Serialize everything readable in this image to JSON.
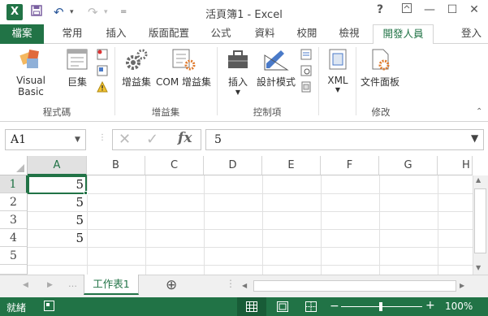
{
  "window": {
    "title": "活頁簿1 - Excel",
    "help": "?",
    "minimize": "—",
    "maximize": "☐",
    "close": "✕"
  },
  "quick_access": {
    "app_icon": "excel-icon",
    "undo_glyph": "↶",
    "redo_glyph": "↷",
    "customize_glyph": "⌄"
  },
  "tabs": [
    "檔案",
    "常用",
    "插入",
    "版面配置",
    "公式",
    "資料",
    "校閱",
    "檢視",
    "開發人員"
  ],
  "active_tab": "開發人員",
  "sign_in": "登入",
  "ribbon": {
    "groups": [
      {
        "label": "程式碼",
        "buttons": [
          "Visual Basic",
          "巨集"
        ]
      },
      {
        "label": "增益集",
        "buttons": [
          "增益集",
          "COM 增益集"
        ]
      },
      {
        "label": "控制項",
        "buttons": [
          "插入",
          "設計模式"
        ]
      },
      {
        "label": "XML",
        "buttons": [
          "XML"
        ]
      },
      {
        "label": "修改",
        "buttons": [
          "文件面板"
        ]
      }
    ]
  },
  "formula_bar": {
    "name_box": "A1",
    "formula_value": "5",
    "fx_label": "fx"
  },
  "grid": {
    "columns": [
      "A",
      "B",
      "C",
      "D",
      "E",
      "F",
      "G",
      "H"
    ],
    "selected_column": "A",
    "rows": [
      "1",
      "2",
      "3",
      "4",
      "5"
    ],
    "selected_row": "1",
    "cells": {
      "A1": "5",
      "A2": "5",
      "A3": "5",
      "A4": "5"
    }
  },
  "sheets": {
    "tabs": [
      "工作表1"
    ],
    "add_label": "⊕"
  },
  "status": {
    "ready": "就緒",
    "zoom": "100%",
    "zoom_minus": "−",
    "zoom_plus": "+"
  },
  "colors": {
    "excel_green": "#217346",
    "gridline": "#e1e1e1",
    "header_selected": "#e1e1e1"
  }
}
